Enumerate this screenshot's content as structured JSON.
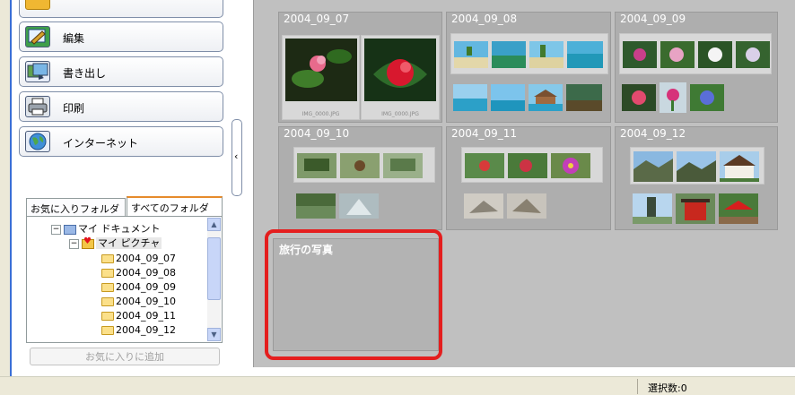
{
  "sidebar": {
    "actions": [
      {
        "label": "編集",
        "icon": "edit-icon"
      },
      {
        "label": "書き出し",
        "icon": "export-icon"
      },
      {
        "label": "印刷",
        "icon": "printer-icon"
      },
      {
        "label": "インターネット",
        "icon": "globe-icon"
      }
    ],
    "collapse_glyph": "‹",
    "tabs": [
      {
        "label": "お気に入りフォルダ",
        "active": false
      },
      {
        "label": "すべてのフォルダ",
        "active": true
      }
    ],
    "tree": [
      {
        "label": "マイ ドキュメント",
        "level": 0,
        "expander": "−"
      },
      {
        "label": "マイ ピクチャ",
        "level": 1,
        "expander": "−"
      },
      {
        "label": "2004_09_07",
        "level": 2
      },
      {
        "label": "2004_09_08",
        "level": 2
      },
      {
        "label": "2004_09_09",
        "level": 2
      },
      {
        "label": "2004_09_10",
        "level": 2
      },
      {
        "label": "2004_09_11",
        "level": 2
      },
      {
        "label": "2004_09_12",
        "level": 2
      }
    ],
    "add_favorite_label": "お気に入りに追加"
  },
  "albums": [
    {
      "title": "2004_09_07",
      "captions": [
        "IMG_0000.JPG",
        "IMG_0000.JPG"
      ]
    },
    {
      "title": "2004_09_08"
    },
    {
      "title": "2004_09_09"
    },
    {
      "title": "2004_09_10"
    },
    {
      "title": "2004_09_11"
    },
    {
      "title": "2004_09_12"
    }
  ],
  "new_album": {
    "title": "旅行の写真"
  },
  "status": {
    "selection": "選択数:0"
  },
  "colors": {
    "highlight": "#e41e1e",
    "album_bg": "#aeaeae",
    "panel_bg": "#c0c0c0",
    "tab_accent": "#e68b2c"
  }
}
